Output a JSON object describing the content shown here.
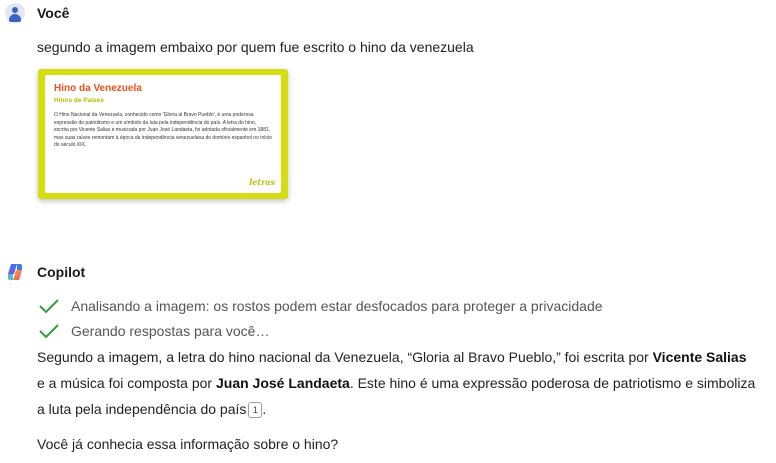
{
  "user": {
    "name": "Você",
    "message": "segundo a imagem embaixo por quem fue escrito o hino da venezuela",
    "attachment": {
      "title": "Hino da Venezuela",
      "subtitle": "Hinos de Países",
      "body": "O Hino Nacional da Venezuela, conhecido como 'Gloria al Bravo Pueblo', é uma poderosa expressão de patriotismo e um símbolo da luta pela independência do país. A letra do hino, escrita por Vicente Salias e musicada por Juan José Landaeta, foi adotada oficialmente em 1881, mas suas raízes remontam à época da independência venezuelana do domínio espanhol no início do século XIX.",
      "logo": "letras"
    }
  },
  "copilot": {
    "name": "Copilot",
    "statuses": [
      "Analisando a imagem: os rostos podem estar desfocados para proteger a privacidade",
      "Gerando respostas para você…"
    ],
    "answer": {
      "part1": "Segundo a imagem, a letra do hino nacional da Venezuela, “Gloria al Bravo Pueblo,” foi escrita por ",
      "author": "Vicente Salias",
      "part2": " e a música foi composta por ",
      "composer": "Juan José Landaeta",
      "part3": ". Este hino é uma expressão poderosa de patriotismo e simboliza a luta pela independência do país",
      "citation": "1",
      "part4": "."
    },
    "followup": "Você já conhecia essa informação sobre o hino?"
  },
  "colors": {
    "check": "#2e9e3e",
    "card_border": "#d6dd12",
    "card_title": "#e8501e"
  }
}
